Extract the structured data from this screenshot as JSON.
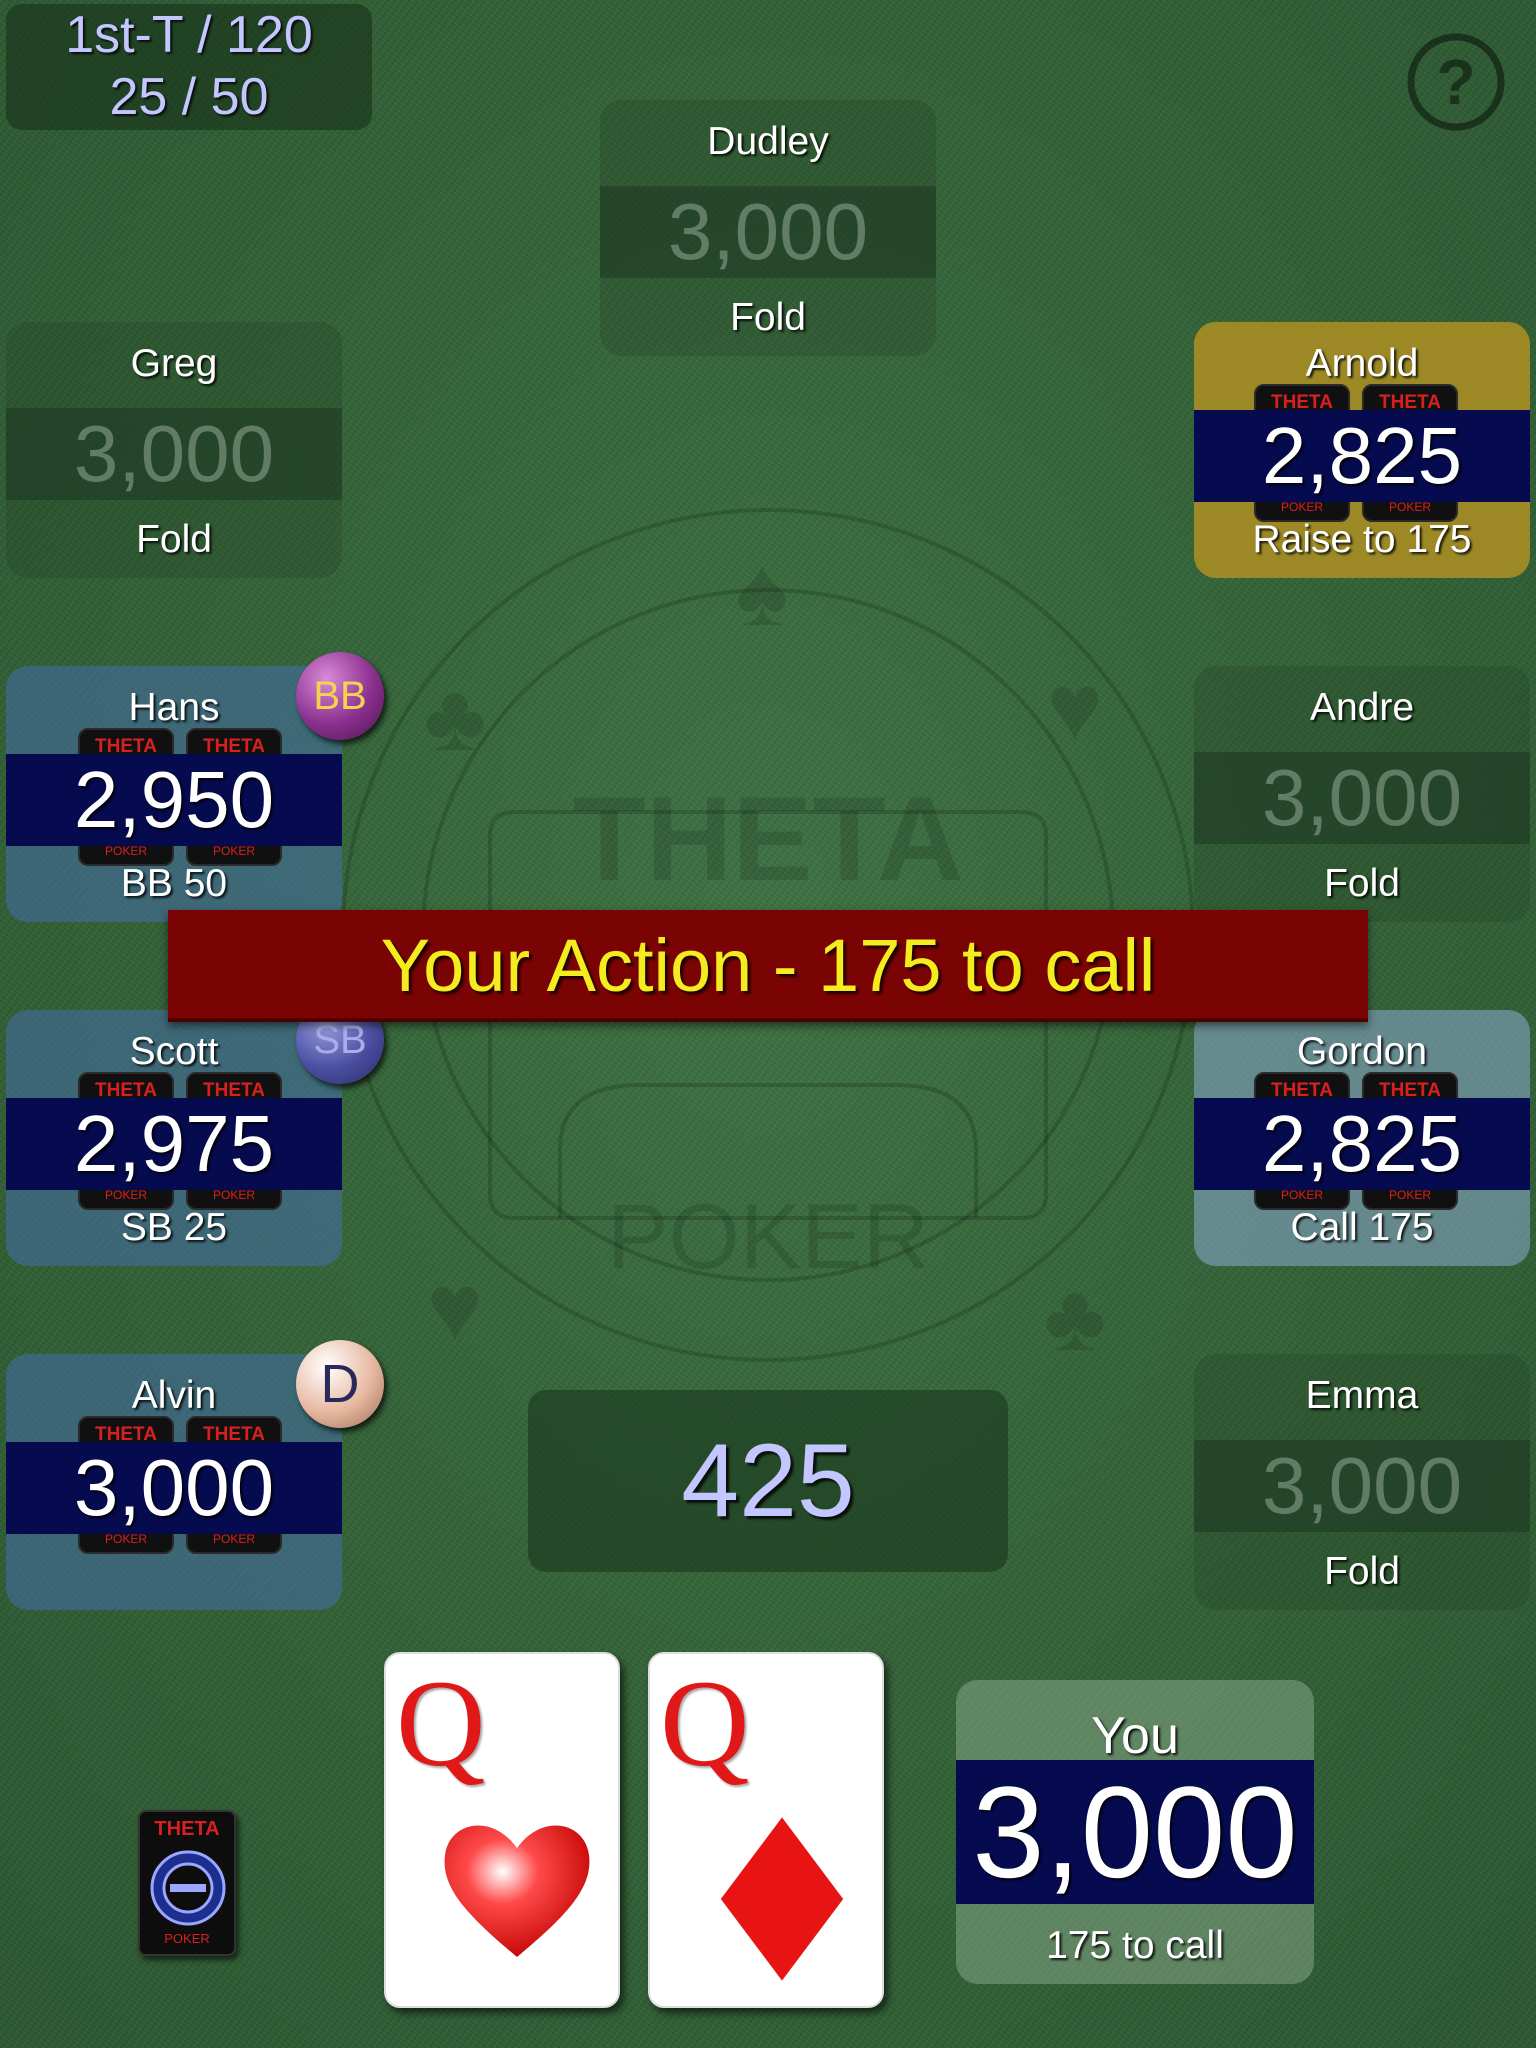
{
  "level": {
    "line1": "1st-T / 120",
    "line2": "25 / 50"
  },
  "help": {
    "label": "?"
  },
  "banner": {
    "text": "Your Action - 175 to call"
  },
  "pot": {
    "amount": "425"
  },
  "card_brand": {
    "top": "THETA",
    "bottom": "POKER"
  },
  "players": {
    "dudley": {
      "name": "Dudley",
      "stack": "3,000",
      "action": "Fold"
    },
    "greg": {
      "name": "Greg",
      "stack": "3,000",
      "action": "Fold"
    },
    "arnold": {
      "name": "Arnold",
      "stack": "2,825",
      "action": "Raise to 175"
    },
    "hans": {
      "name": "Hans",
      "stack": "2,950",
      "action": "BB 50",
      "button": "BB"
    },
    "andre": {
      "name": "Andre",
      "stack": "3,000",
      "action": "Fold"
    },
    "scott": {
      "name": "Scott",
      "stack": "2,975",
      "action": "SB 25",
      "button": "SB"
    },
    "gordon": {
      "name": "Gordon",
      "stack": "2,825",
      "action": "Call 175"
    },
    "alvin": {
      "name": "Alvin",
      "stack": "3,000",
      "action": "",
      "button": "D"
    },
    "emma": {
      "name": "Emma",
      "stack": "3,000",
      "action": "Fold"
    }
  },
  "you": {
    "name": "You",
    "stack": "3,000",
    "action": "175 to call"
  },
  "hero_cards": [
    {
      "rank": "Q",
      "suit": "heart-suit"
    },
    {
      "rank": "Q",
      "suit": "diamond-suit"
    }
  ],
  "colors": {
    "felt": "#356539",
    "banner_bg": "#7a0303",
    "banner_text": "#f3ec1f",
    "stack_band": "#060a4e",
    "raiser_seat": "#af9123",
    "pot_text": "#c4c6ff"
  }
}
